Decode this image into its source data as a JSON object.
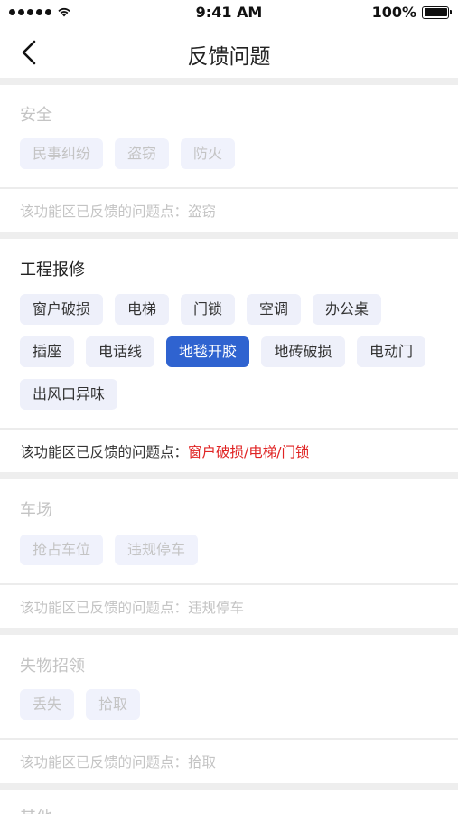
{
  "status_bar": {
    "time": "9:41 AM",
    "battery": "100%"
  },
  "nav": {
    "title": "反馈问题"
  },
  "sections": [
    {
      "title": "安全",
      "tags": [
        "民事纠纷",
        "盗窃",
        "防火"
      ],
      "footer_label": "该功能区已反馈的问题点：",
      "footer_value": "盗窃"
    },
    {
      "title": "工程报修",
      "tags": [
        "窗户破损",
        "电梯",
        "门锁",
        "空调",
        "办公桌",
        "插座",
        "电话线",
        "地毯开胶",
        "地砖破损",
        "电动门",
        "出风口异味"
      ],
      "selected_tag": "地毯开胶",
      "footer_label": "该功能区已反馈的问题点：",
      "footer_value": "窗户破损/电梯/门锁",
      "footer_value_color": "#e02424"
    },
    {
      "title": "车场",
      "tags": [
        "抢占车位",
        "违规停车"
      ],
      "footer_label": "该功能区已反馈的问题点：",
      "footer_value": "违规停车"
    },
    {
      "title": "失物招领",
      "tags": [
        "丢失",
        "拾取"
      ],
      "footer_label": "该功能区已反馈的问题点：",
      "footer_value": "拾取"
    },
    {
      "title": "其他"
    }
  ],
  "colors": {
    "accent": "#2f63d0",
    "highlight_text": "#e02424",
    "disabled_text": "#c4c4c4",
    "tag_bg": "#eef0fa"
  }
}
